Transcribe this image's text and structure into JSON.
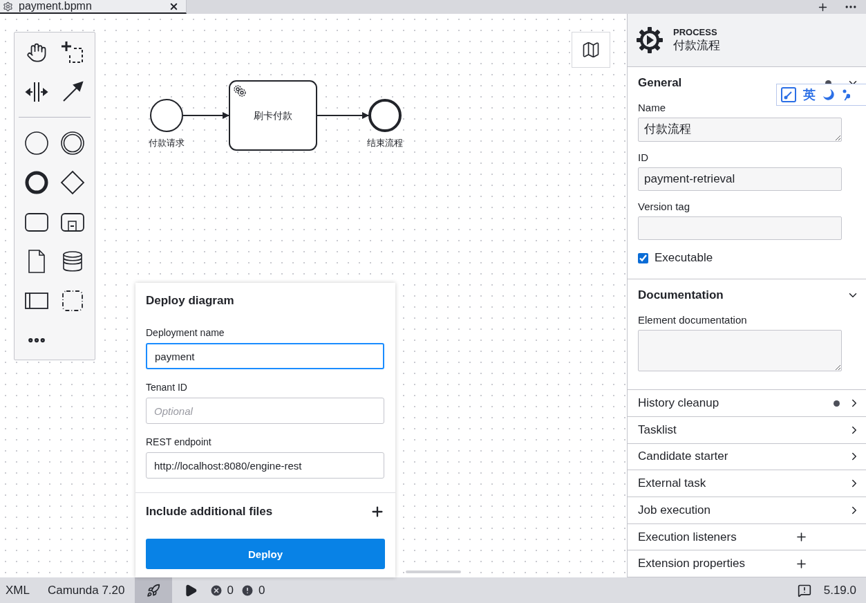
{
  "tabs": [
    {
      "label": "payment.bpmn",
      "selected": true
    }
  ],
  "diagram": {
    "nodes": [
      {
        "kind": "start_event",
        "label": "付款请求"
      },
      {
        "kind": "service_task",
        "label": "刷卡付款"
      },
      {
        "kind": "end_event",
        "label": "结束流程"
      }
    ]
  },
  "properties": {
    "element_type": "PROCESS",
    "element_name": "付款流程",
    "general": {
      "title": "General",
      "has_data": true,
      "expanded": true,
      "fields": [
        {
          "kind": "textarea",
          "label": "Name",
          "value": "付款流程"
        },
        {
          "kind": "text",
          "label": "ID",
          "value": "payment-retrieval"
        },
        {
          "kind": "text",
          "label": "Version tag"
        }
      ],
      "checkbox": {
        "label": "Executable",
        "checked": true
      }
    },
    "documentation": {
      "title": "Documentation",
      "expanded": true,
      "fields": [
        {
          "kind": "textarea",
          "label": "Element documentation"
        }
      ]
    },
    "groups": [
      {
        "kind": "collapsible",
        "title": "History cleanup",
        "has_data": true
      },
      {
        "kind": "collapsible",
        "title": "Tasklist",
        "has_data": false
      },
      {
        "kind": "collapsible",
        "title": "Candidate starter",
        "has_data": false
      },
      {
        "kind": "collapsible",
        "title": "External task",
        "has_data": false
      },
      {
        "kind": "collapsible",
        "title": "Job execution",
        "has_data": false
      },
      {
        "kind": "list",
        "title": "Execution listeners",
        "has_data": false
      },
      {
        "kind": "list",
        "title": "Extension properties",
        "has_data": false
      }
    ]
  },
  "ime_toolbar": {
    "mode": "英"
  },
  "deploy": {
    "title": "Deploy diagram",
    "fields": [
      {
        "label": "Deployment name",
        "value": "payment",
        "focused": true
      },
      {
        "label": "Tenant ID",
        "placeholder": "Optional",
        "focused": false
      },
      {
        "label": "REST endpoint",
        "value": "http://localhost:8080/engine-rest",
        "focused": false
      }
    ],
    "additional_files": "Include additional files",
    "button": "Deploy"
  },
  "status_bar": {
    "format": "XML",
    "engine": "Camunda 7.20",
    "deploy_selected": true,
    "errors": "0",
    "warnings": "0",
    "version": "5.19.0"
  }
}
